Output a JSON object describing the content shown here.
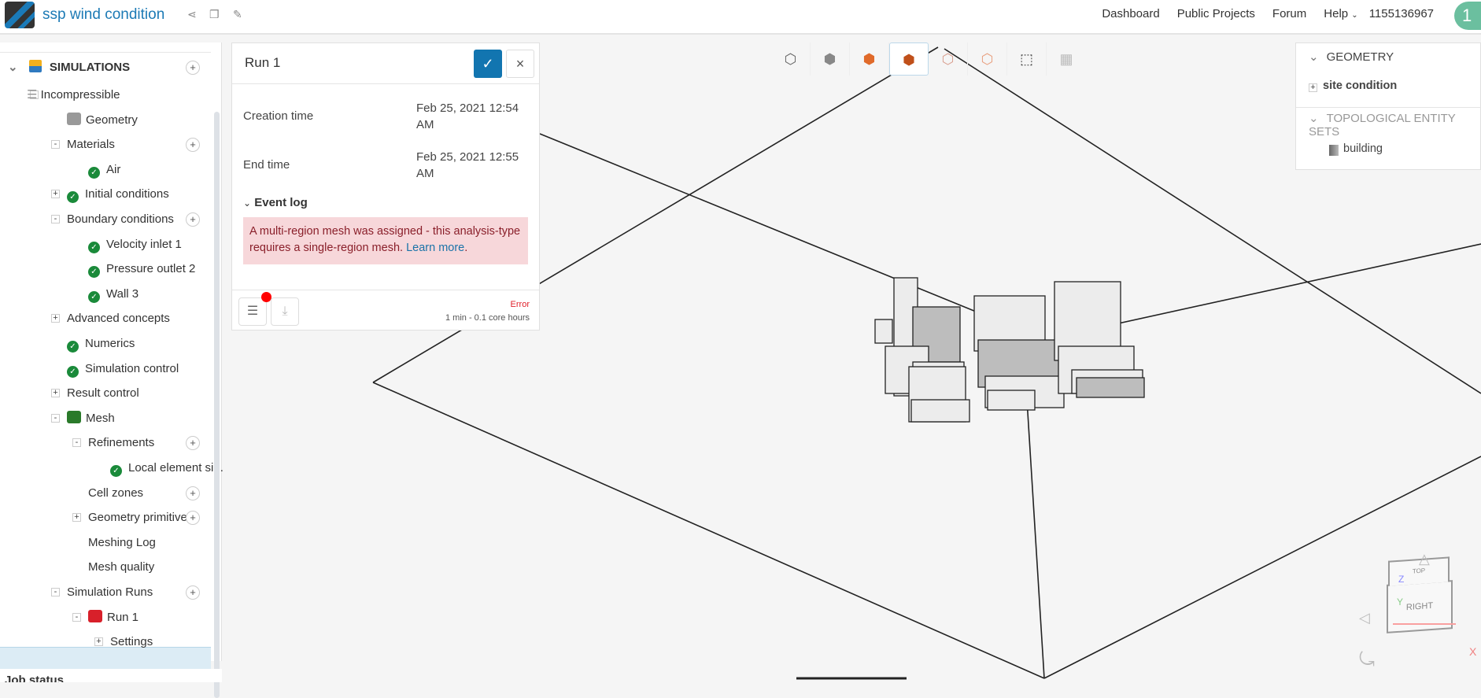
{
  "header": {
    "title": "ssp wind condition",
    "nav": [
      "Dashboard",
      "Public Projects",
      "Forum",
      "Help"
    ],
    "user": "1155136967",
    "avatar": "1",
    "icons": [
      "share-icon",
      "copy-icon",
      "edit-icon"
    ]
  },
  "tree": {
    "root": "SIMULATIONS",
    "items": [
      {
        "label": "Incompressible",
        "depth": 0,
        "toggle": "-"
      },
      {
        "label": "Geometry",
        "depth": 1,
        "icon": "geometry-check-icon"
      },
      {
        "label": "Materials",
        "depth": 1,
        "toggle": "-",
        "add": true
      },
      {
        "label": "Air",
        "depth": 2,
        "check": true
      },
      {
        "label": "Initial conditions",
        "depth": 1,
        "toggle": "+",
        "check": true
      },
      {
        "label": "Boundary conditions",
        "depth": 1,
        "toggle": "-",
        "add": true
      },
      {
        "label": "Velocity inlet 1",
        "depth": 2,
        "check": true
      },
      {
        "label": "Pressure outlet 2",
        "depth": 2,
        "check": true
      },
      {
        "label": "Wall 3",
        "depth": 2,
        "check": true
      },
      {
        "label": "Advanced concepts",
        "depth": 1,
        "toggle": "+"
      },
      {
        "label": "Numerics",
        "depth": 1,
        "check": true
      },
      {
        "label": "Simulation control",
        "depth": 1,
        "check": true
      },
      {
        "label": "Result control",
        "depth": 1,
        "toggle": "+"
      },
      {
        "label": "Mesh",
        "depth": 1,
        "toggle": "-",
        "icon": "mesh-check-icon"
      },
      {
        "label": "Refinements",
        "depth": 2,
        "toggle": "-",
        "add": true
      },
      {
        "label": "Local element si...",
        "depth": 3,
        "check": true
      },
      {
        "label": "Cell zones",
        "depth": 2,
        "add": true
      },
      {
        "label": "Geometry primitives",
        "depth": 2,
        "toggle": "+",
        "add": true
      },
      {
        "label": "Meshing Log",
        "depth": 2
      },
      {
        "label": "Mesh quality",
        "depth": 2
      },
      {
        "label": "Simulation Runs",
        "depth": 1,
        "toggle": "-",
        "add": true
      },
      {
        "label": "Run 1",
        "depth": 2,
        "toggle": "-",
        "icon": "run-error-icon",
        "selected": true
      },
      {
        "label": "Settings",
        "depth": 3,
        "toggle": "+"
      }
    ]
  },
  "job_status": "Job status",
  "run_panel": {
    "title": "Run 1",
    "creation_label": "Creation time",
    "creation_value": "Feb 25, 2021 12:54 AM",
    "end_label": "End time",
    "end_value": "Feb 25, 2021 12:55 AM",
    "event_log": "Event log",
    "error_message": "A multi-region mesh was assigned - this analysis-type requires a single-region mesh.",
    "learn_more": "Learn more",
    "status": "Error",
    "usage": "1 min - 0.1 core hours"
  },
  "right_panel": {
    "geometry": "GEOMETRY",
    "site": "site condition",
    "topo": "TOPOLOGICAL ENTITY SETS",
    "building": "building"
  },
  "navcube": {
    "top": "TOP",
    "right": "RIGHT",
    "x": "X",
    "y": "Y",
    "z": "Z"
  },
  "colors": {
    "accent": "#1275b0",
    "error": "#e0202a",
    "check": "#1a8a3a"
  }
}
